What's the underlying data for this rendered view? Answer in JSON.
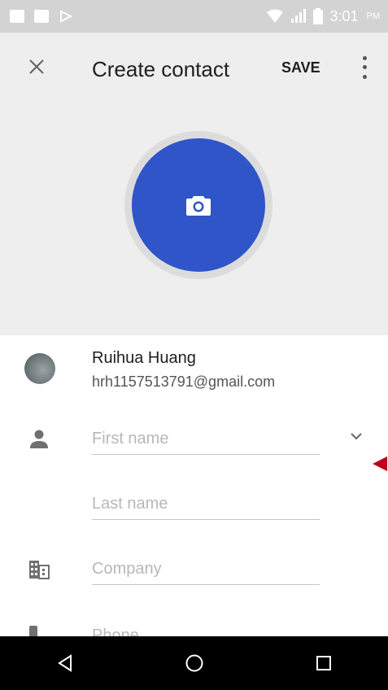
{
  "status_bar": {
    "time": "3:01",
    "period": "PM",
    "left_icons": [
      "image-icon",
      "activity-icon",
      "cast-icon"
    ],
    "right_icons": [
      "wifi-icon",
      "signal-icon",
      "battery-icon"
    ]
  },
  "app_bar": {
    "close_icon": "close-icon",
    "title": "Create contact",
    "save_label": "SAVE",
    "more_icon": "more-vert-icon",
    "background": "#eeeeee"
  },
  "photo": {
    "icon": "camera-icon",
    "circle_color": "#2f55c8"
  },
  "account": {
    "name": "Ruihua Huang",
    "email": "hrh1157513791@gmail.com"
  },
  "fields": {
    "first_name_placeholder": "First name",
    "last_name_placeholder": "Last name",
    "company_placeholder": "Company",
    "phone_placeholder": "Phone"
  },
  "icons": {
    "person": "person-icon",
    "company": "business-icon",
    "phone": "phone-icon",
    "expand": "chevron-down-icon"
  },
  "annotation": {
    "pointer_color": "#c0001a"
  },
  "nav_bar": {
    "back": "back-icon",
    "home": "home-icon",
    "recents": "recents-icon"
  }
}
